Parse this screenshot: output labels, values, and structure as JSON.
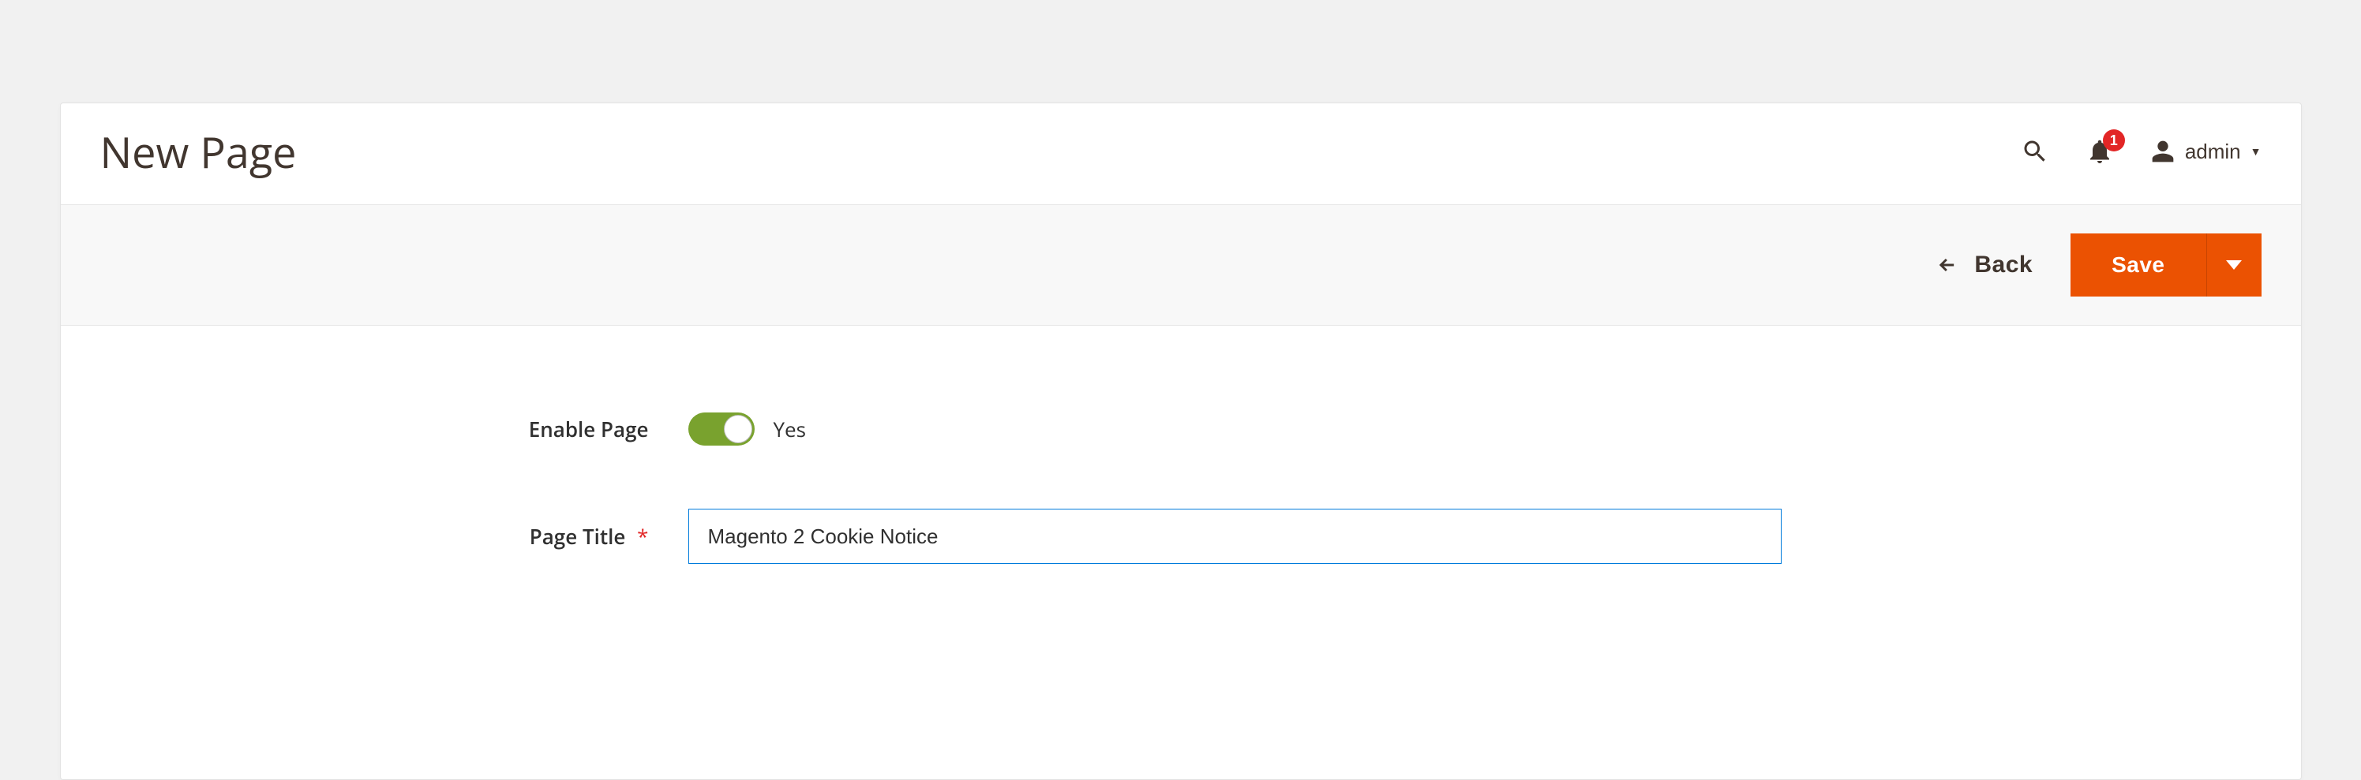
{
  "header": {
    "title": "New Page",
    "notifications_count": "1",
    "user_label": "admin"
  },
  "actions": {
    "back_label": "Back",
    "save_label": "Save"
  },
  "form": {
    "enable_page": {
      "label": "Enable Page",
      "value_text": "Yes",
      "enabled": true
    },
    "page_title": {
      "label": "Page Title",
      "required_marker": "*",
      "value": "Magento 2 Cookie Notice"
    }
  },
  "colors": {
    "accent": "#eb5202",
    "toggle_on": "#79a22e",
    "danger": "#e22626",
    "focus": "#007bdb"
  }
}
